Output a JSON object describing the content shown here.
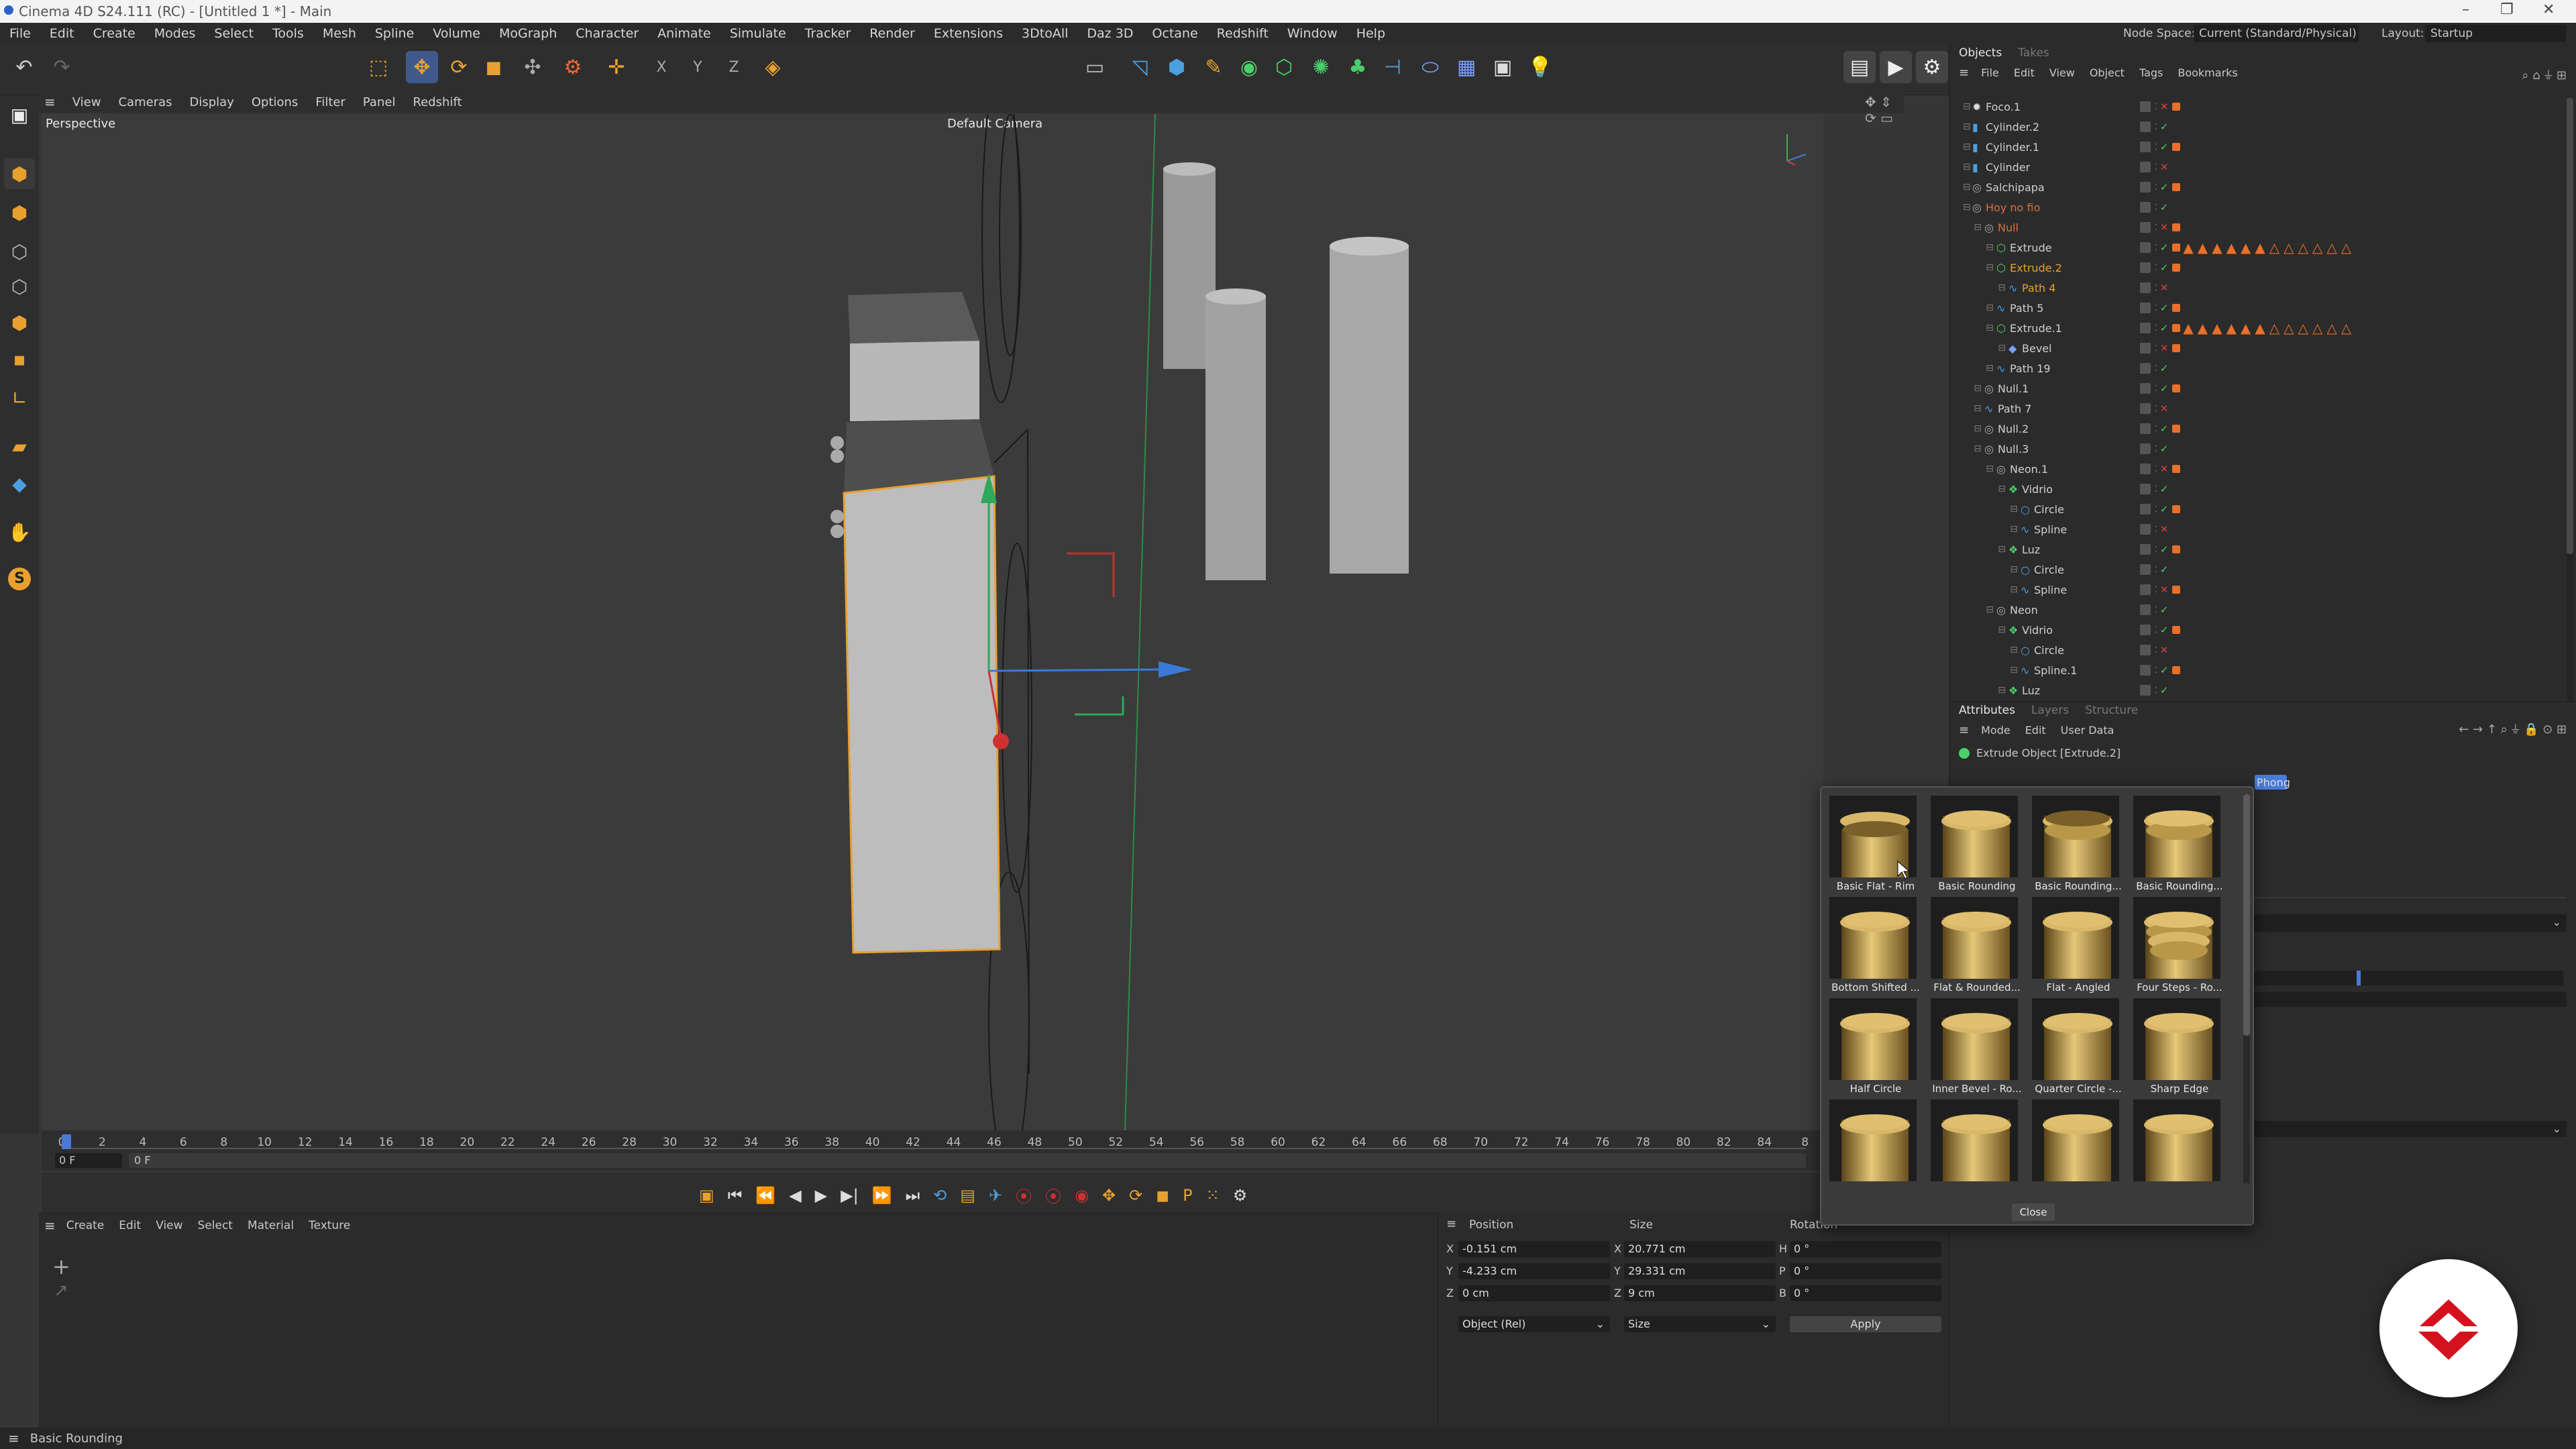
{
  "window": {
    "title": "Cinema 4D S24.111 (RC) - [Untitled 1 *] - Main"
  },
  "menubar": {
    "items": [
      "File",
      "Edit",
      "Create",
      "Modes",
      "Select",
      "Tools",
      "Mesh",
      "Spline",
      "Volume",
      "MoGraph",
      "Character",
      "Animate",
      "Simulate",
      "Tracker",
      "Render",
      "Extensions",
      "3DtoAll",
      "Daz 3D",
      "Octane",
      "Redshift",
      "Window",
      "Help"
    ],
    "node_space_label": "Node Space:",
    "node_space_value": "Current (Standard/Physical)",
    "layout_label": "Layout:",
    "layout_value": "Startup"
  },
  "viewport": {
    "menu": [
      "View",
      "Cameras",
      "Display",
      "Options",
      "Filter",
      "Panel",
      "Redshift"
    ],
    "projection": "Perspective",
    "camera": "Default Camera"
  },
  "timeline": {
    "ticks": [
      "0",
      "2",
      "4",
      "6",
      "8",
      "10",
      "12",
      "14",
      "16",
      "18",
      "20",
      "22",
      "24",
      "26",
      "28",
      "30",
      "32",
      "34",
      "36",
      "38",
      "40",
      "42",
      "44",
      "46",
      "48",
      "50",
      "52",
      "54",
      "56",
      "58",
      "60",
      "62",
      "64",
      "66",
      "68",
      "70",
      "72",
      "74",
      "76",
      "78",
      "80",
      "82",
      "84",
      "8"
    ],
    "current_frame": "0 F",
    "start_frame": "0 F"
  },
  "objects_panel": {
    "tabs": [
      "Objects",
      "Takes"
    ],
    "menu": [
      "File",
      "Edit",
      "View",
      "Object",
      "Tags",
      "Bookmarks"
    ],
    "rows": [
      {
        "name": "Foco.1",
        "indent": 0,
        "icon": "light"
      },
      {
        "name": "Cylinder.2",
        "indent": 0,
        "icon": "cylinder"
      },
      {
        "name": "Cylinder.1",
        "indent": 0,
        "icon": "cylinder"
      },
      {
        "name": "Cylinder",
        "indent": 0,
        "icon": "cylinder"
      },
      {
        "name": "Salchipapa",
        "indent": 0,
        "icon": "null"
      },
      {
        "name": "Hoy no fio",
        "indent": 0,
        "icon": "null",
        "color": "#d87040"
      },
      {
        "name": "Null",
        "indent": 1,
        "icon": "null",
        "color": "#d87040"
      },
      {
        "name": "Extrude",
        "indent": 2,
        "icon": "extrude"
      },
      {
        "name": "Extrude.2",
        "indent": 2,
        "icon": "extrude",
        "color": "#e8a030"
      },
      {
        "name": "Path 4",
        "indent": 3,
        "icon": "spline",
        "color": "#e8a030"
      },
      {
        "name": "Path 5",
        "indent": 2,
        "icon": "spline"
      },
      {
        "name": "Extrude.1",
        "indent": 2,
        "icon": "extrude"
      },
      {
        "name": "Bevel",
        "indent": 3,
        "icon": "bevel"
      },
      {
        "name": "Path 19",
        "indent": 2,
        "icon": "spline"
      },
      {
        "name": "Null.1",
        "indent": 1,
        "icon": "null"
      },
      {
        "name": "Path 7",
        "indent": 1,
        "icon": "spline"
      },
      {
        "name": "Null.2",
        "indent": 1,
        "icon": "null"
      },
      {
        "name": "Null.3",
        "indent": 1,
        "icon": "null"
      },
      {
        "name": "Neon.1",
        "indent": 2,
        "icon": "null"
      },
      {
        "name": "Vidrio",
        "indent": 3,
        "icon": "sweep"
      },
      {
        "name": "Circle",
        "indent": 4,
        "icon": "circle"
      },
      {
        "name": "Spline",
        "indent": 4,
        "icon": "spline"
      },
      {
        "name": "Luz",
        "indent": 3,
        "icon": "sweep"
      },
      {
        "name": "Circle",
        "indent": 4,
        "icon": "circle"
      },
      {
        "name": "Spline",
        "indent": 4,
        "icon": "spline"
      },
      {
        "name": "Neon",
        "indent": 2,
        "icon": "null"
      },
      {
        "name": "Vidrio",
        "indent": 3,
        "icon": "sweep"
      },
      {
        "name": "Circle",
        "indent": 4,
        "icon": "circle"
      },
      {
        "name": "Spline.1",
        "indent": 4,
        "icon": "spline"
      },
      {
        "name": "Luz",
        "indent": 3,
        "icon": "sweep"
      }
    ]
  },
  "attributes_panel": {
    "tabs": [
      "Attributes",
      "Layers",
      "Structure"
    ],
    "menu": [
      "Mode",
      "Edit",
      "User Data"
    ],
    "object_title": "Extrude Object [Extrude.2]",
    "visible_tab": "Phong"
  },
  "material_panel": {
    "menu": [
      "Create",
      "Edit",
      "View",
      "Select",
      "Material",
      "Texture"
    ]
  },
  "coord_panel": {
    "headers": [
      "Position",
      "Size",
      "Rotation"
    ],
    "rows": [
      {
        "axis": "X",
        "pos": "-0.151 cm",
        "saxis": "X",
        "size": "20.771 cm",
        "raxis": "H",
        "rot": "0 °"
      },
      {
        "axis": "Y",
        "pos": "-4.233 cm",
        "saxis": "Y",
        "size": "29.331 cm",
        "raxis": "P",
        "rot": "0 °"
      },
      {
        "axis": "Z",
        "pos": "0 cm",
        "saxis": "Z",
        "size": "9 cm",
        "raxis": "B",
        "rot": "0 °"
      }
    ],
    "mode_select": "Object (Rel)",
    "size_select": "Size",
    "apply_label": "Apply"
  },
  "bevel_popup": {
    "presets": [
      "Basic Flat - Rim",
      "Basic Rounding",
      "Basic Rounding...",
      "Basic Rounding...",
      "Bottom Shifted ...",
      "Flat & Rounded...",
      "Flat - Angled",
      "Four Steps - Ro...",
      "Half Circle",
      "Inner Bevel - Ro...",
      "Quarter Circle -...",
      "Sharp Edge",
      "",
      "",
      "",
      ""
    ],
    "close_label": "Close"
  },
  "status": {
    "text": "Basic Rounding"
  },
  "colors": {
    "accent": "#e8a030",
    "selection_orange": "#d87040",
    "logo_red": "#d4121e"
  }
}
